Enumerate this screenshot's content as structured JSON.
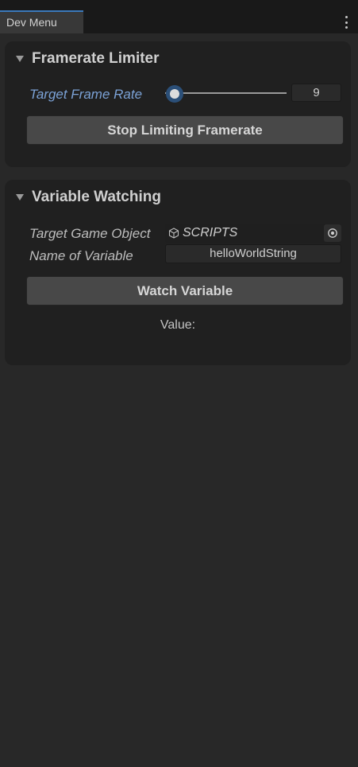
{
  "window": {
    "tab_title": "Dev Menu",
    "menu_icon": "kebab-menu-icon"
  },
  "framerate_limiter": {
    "title": "Framerate Limiter",
    "expanded": true,
    "target_frame_rate_label": "Target Frame Rate",
    "target_frame_rate_value": "9",
    "slider_fraction": 0.0,
    "stop_button_label": "Stop Limiting Framerate"
  },
  "variable_watching": {
    "title": "Variable Watching",
    "expanded": true,
    "target_game_object_label": "Target Game Object",
    "target_game_object_value": "SCRIPTS",
    "object_icon": "cube-icon",
    "picker_icon": "object-picker-icon",
    "variable_name_label": "Name of Variable",
    "variable_name_value": "helloWorldString",
    "watch_button_label": "Watch Variable",
    "value_label": "Value:"
  },
  "colors": {
    "background": "#282828",
    "section_background": "#202020",
    "accent_label": "#7ba2d6",
    "tab_accent": "#3a79bb"
  }
}
